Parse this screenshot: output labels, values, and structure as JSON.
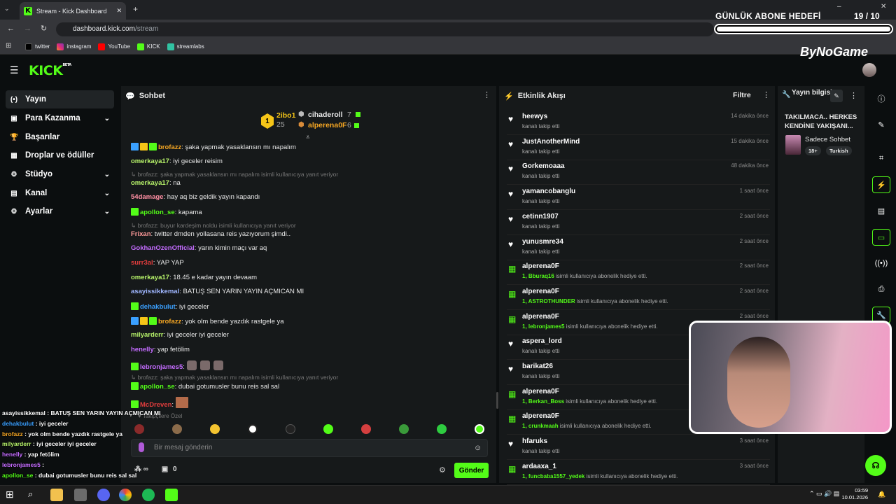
{
  "browser": {
    "tab_title": "Stream - Kick Dashboard",
    "url_host": "dashboard.kick.com",
    "url_path": "/stream",
    "bookmarks": [
      "twitter",
      "instagram",
      "YouTube",
      "KICK",
      "streamlabs"
    ]
  },
  "overlay": {
    "goal_title": "GÜNLÜK ABONE HEDEFİ",
    "goal_current": "19",
    "goal_target": "/ 10",
    "goal_progress": 1.0,
    "brand": "ByNoGame"
  },
  "kick": {
    "logo": "KICK",
    "logo_tag": "BETA"
  },
  "sidebar": {
    "items": [
      {
        "label": "Yayın",
        "icon": "broadcast-icon",
        "active": true,
        "chevron": false
      },
      {
        "label": "Para Kazanma",
        "icon": "wallet-icon",
        "active": false,
        "chevron": true
      },
      {
        "label": "Başarılar",
        "icon": "trophy-icon",
        "active": false,
        "chevron": false
      },
      {
        "label": "Droplar ve ödüller",
        "icon": "gift-icon",
        "active": false,
        "chevron": false
      },
      {
        "label": "Stüdyo",
        "icon": "studio-icon",
        "active": false,
        "chevron": true
      },
      {
        "label": "Kanal",
        "icon": "channel-icon",
        "active": false,
        "chevron": true
      },
      {
        "label": "Ayarlar",
        "icon": "gear-icon",
        "active": false,
        "chevron": true
      }
    ]
  },
  "chat": {
    "title": "Sohbet",
    "leaderboard": {
      "first_name": "2ibo1",
      "first_count": "25",
      "second_name": "cihaderoll",
      "second_count": "7",
      "third_name": "alperena0F",
      "third_count": "6"
    },
    "messages": [
      {
        "type": "msg",
        "user": "brofazz",
        "color": "#f5a623",
        "text": ": şaka yapmak yasaklansın mı napalım"
      },
      {
        "type": "msg",
        "user": "omerkaya17",
        "color": "#b7f36a",
        "text": ": iyi geceler reisim"
      },
      {
        "type": "reply",
        "text": "↳ brofazz: şaka yapmak yasaklansın mı napalım isimli kullanıcıya yanıt veriyor"
      },
      {
        "type": "msg",
        "user": "omerkaya17",
        "color": "#b7f36a",
        "text": ": na"
      },
      {
        "type": "msg",
        "user": "54damage",
        "color": "#ff8fa3",
        "text": ": hay aq biz geldik yayın kapandı"
      },
      {
        "type": "msg",
        "user": "apollon_se",
        "color": "#53fc18",
        "text": ": kapama"
      },
      {
        "type": "reply",
        "text": "↳ brofazz: buyur kardeşim noldu isimli kullanıcıya yanıt veriyor"
      },
      {
        "type": "msg",
        "user": "Frixan",
        "color": "#ff9a9a",
        "text": ": twitter dmden yollasana reis yazıyorum şimdi.."
      },
      {
        "type": "msg",
        "user": "GokhanOzenOfficial",
        "color": "#c46cff",
        "text": ": yarın kimin maçı var aq"
      },
      {
        "type": "msg",
        "user": "surr3al",
        "color": "#e23d3d",
        "text": ": YAP YAP"
      },
      {
        "type": "msg",
        "user": "omerkaya17",
        "color": "#b7f36a",
        "text": ": 18.45 e kadar yayın devaam"
      },
      {
        "type": "msg",
        "user": "asayissikkemal",
        "color": "#9fb6ff",
        "text": ": BATUŞ SEN YARIN YAYIN AÇMICAN MI"
      },
      {
        "type": "msg",
        "user": "dehakbulut",
        "color": "#3aa0ff",
        "text": ": iyi geceler"
      },
      {
        "type": "msg",
        "user": "brofazz",
        "color": "#f5a623",
        "text": ": yok olm bende yazdık rastgele ya"
      },
      {
        "type": "msg",
        "user": "milyarderr",
        "color": "#b7f36a",
        "text": ": iyi geceler iyi geceler"
      },
      {
        "type": "msg",
        "user": "henelly",
        "color": "#c46cff",
        "text": ": yap fetölim"
      },
      {
        "type": "msg",
        "user": "lebronjames5",
        "color": "#c46cff",
        "text": ":"
      },
      {
        "type": "reply",
        "text": "↳ brofazz: şaka yapmak yasaklansın mı napalım isimli kullanıcıya yanıt veriyor"
      },
      {
        "type": "msg",
        "user": "apollon_se",
        "color": "#53fc18",
        "text": ": dubai gotumusler bunu reis sal sal"
      },
      {
        "type": "msg",
        "user": "McDreven",
        "color": "#e23d3d",
        "text": ":"
      }
    ],
    "follow_only": "Takipçilere Özel",
    "placeholder": "Bir mesaj gönderin",
    "send_label": "Gönder",
    "stat_infinity": "∞",
    "stat_zero": "0"
  },
  "activity": {
    "title": "Etkinlik Akışı",
    "filter_label": "Filtre",
    "items": [
      {
        "kind": "follow",
        "name": "heewys",
        "desc": "kanalı takip etti",
        "time": "14 dakika önce"
      },
      {
        "kind": "follow",
        "name": "JustAnotherMind",
        "desc": "kanalı takip etti",
        "time": "15 dakika önce"
      },
      {
        "kind": "follow",
        "name": "Gorkemoaaa",
        "desc": "kanalı takip etti",
        "time": "48 dakika önce"
      },
      {
        "kind": "follow",
        "name": "yamancobanglu",
        "desc": "kanalı takip etti",
        "time": "1 saat önce"
      },
      {
        "kind": "follow",
        "name": "cetinn1907",
        "desc": "kanalı takip etti",
        "time": "2 saat önce"
      },
      {
        "kind": "follow",
        "name": "yunusmre34",
        "desc": "kanalı takip etti",
        "time": "2 saat önce"
      },
      {
        "kind": "gift",
        "name": "alperena0F",
        "recipient": "1, Bburaq16",
        "desc": " isimli kullanıcıya abonelik hediye etti.",
        "time": "2 saat önce"
      },
      {
        "kind": "gift",
        "name": "alperena0F",
        "recipient": "1, ASTROTHUNDER",
        "desc": " isimli kullanıcıya abonelik hediye etti.",
        "time": "2 saat önce"
      },
      {
        "kind": "gift",
        "name": "alperena0F",
        "recipient": "1, lebronjames5",
        "desc": " isimli kullanıcıya abonelik hediye etti.",
        "time": "2 saat önce"
      },
      {
        "kind": "follow",
        "name": "aspera_lord",
        "desc": "kanalı takip etti",
        "time": ""
      },
      {
        "kind": "follow",
        "name": "barikat26",
        "desc": "kanalı takip etti",
        "time": ""
      },
      {
        "kind": "gift",
        "name": "alperena0F",
        "recipient": "1, Berkan_Boss",
        "desc": " isimli kullanıcıya abonelik hediye etti.",
        "time": ""
      },
      {
        "kind": "gift",
        "name": "alperena0F",
        "recipient": "1, crunkmaah",
        "desc": " isimli kullanıcıya abonelik hediye etti.",
        "time": ""
      },
      {
        "kind": "follow",
        "name": "hfaruks",
        "desc": "kanalı takip etti",
        "time": "3 saat önce"
      },
      {
        "kind": "gift",
        "name": "ardaaxa_1",
        "recipient": "1, funcbaba1557_yedek",
        "desc": " isimli kullanıcıya abonelik hediye etti.",
        "time": "3 saat önce"
      }
    ]
  },
  "stream_info": {
    "title": "Yayın bilgisi",
    "stream_title": "TAKILMACA.. HERKES KENDİNE YAKIŞANI...",
    "category": "Sadece Sohbet",
    "tags": [
      "18+",
      "Turkish"
    ]
  },
  "obs_overlay": {
    "lines": [
      {
        "user": "asayissikkemal",
        "text": " : BATUŞ SEN YARIN YAYIN AÇMICAN MI",
        "color": "#ffffff"
      },
      {
        "user": "dehakbulut",
        "text": " : iyi geceler",
        "color": "#3aa0ff"
      },
      {
        "user": "brofazz",
        "text": " : yok olm bende yazdık rastgele ya",
        "color": "#f5a623"
      },
      {
        "user": "milyarderr",
        "text": " : iyi geceler iyi geceler",
        "color": "#b7f36a"
      },
      {
        "user": "henelly",
        "text": " : yap fetölim",
        "color": "#c46cff"
      },
      {
        "user": "lebronjames5",
        "text": " :",
        "color": "#c46cff"
      },
      {
        "user": "apollon_se",
        "text": " : dubai gotumusler bunu reis sal sal",
        "color": "#53fc18"
      }
    ]
  },
  "taskbar": {
    "time": "03:59",
    "date": "10.01.2026"
  },
  "colors": {
    "accent": "#53fc18",
    "panel": "#16191a",
    "bg": "#0b0e0f"
  }
}
